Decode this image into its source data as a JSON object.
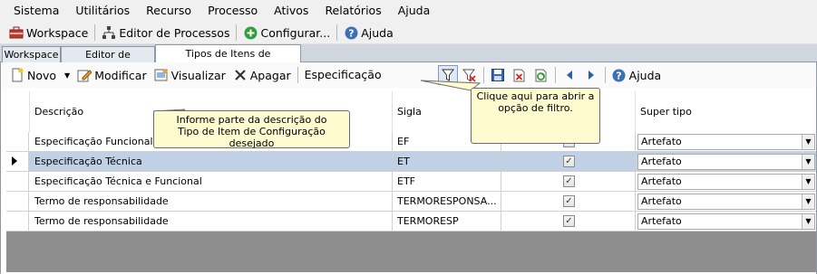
{
  "menu": [
    "Sistema",
    "Utilitários",
    "Recurso",
    "Processo",
    "Ativos",
    "Relatórios",
    "Ajuda"
  ],
  "toolbar": {
    "workspace": "Workspace",
    "editor": "Editor de Processos",
    "configurar": "Configurar...",
    "ajuda": "Ajuda"
  },
  "tabs": [
    "Workspace",
    "Editor de Processos",
    "Tipos de Itens de Configuração"
  ],
  "panel_toolbar": {
    "novo": "Novo",
    "modificar": "Modificar",
    "visualizar": "Visualizar",
    "apagar": "Apagar",
    "search_value": "Especificação",
    "ajuda": "Ajuda"
  },
  "grid": {
    "headers": [
      "Descrição",
      "Sigla",
      "",
      "Super tipo"
    ],
    "rows": [
      {
        "descricao": "Especificação Funcional",
        "sigla": "EF",
        "checked": true,
        "supertipo": "Artefato"
      },
      {
        "descricao": "Especificação Técnica",
        "sigla": "ET",
        "checked": true,
        "supertipo": "Artefato"
      },
      {
        "descricao": "Especificação Técnica e Funcional",
        "sigla": "ETF",
        "checked": true,
        "supertipo": "Artefato"
      },
      {
        "descricao": "Termo de responsabilidade",
        "sigla": "TERMORESPONSA...",
        "checked": true,
        "supertipo": "Artefato"
      },
      {
        "descricao": "Termo de responsabilidade",
        "sigla": "TERMORESP",
        "checked": true,
        "supertipo": "Artefato"
      }
    ],
    "selected_row": 1
  },
  "callouts": {
    "search": "Informe parte da descrição do Tipo de Item de Configuração desejado",
    "filter": "Clique aqui para abrir a opção de filtro."
  }
}
